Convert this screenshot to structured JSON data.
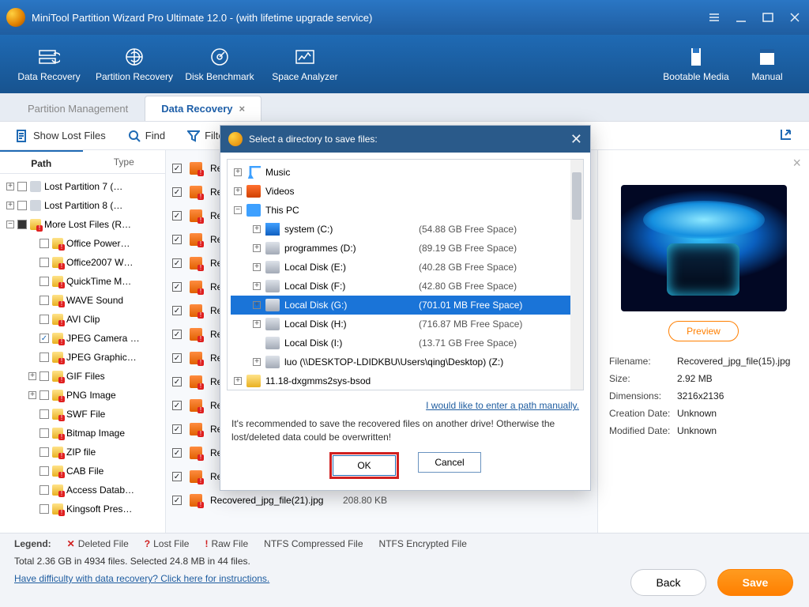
{
  "titlebar": {
    "title": "MiniTool Partition Wizard Pro Ultimate 12.0 - (with lifetime upgrade service)"
  },
  "ribbon": {
    "data_recovery": "Data Recovery",
    "partition_recovery": "Partition Recovery",
    "disk_benchmark": "Disk Benchmark",
    "space_analyzer": "Space Analyzer",
    "bootable_media": "Bootable Media",
    "manual": "Manual"
  },
  "main_tabs": {
    "partition_mgmt": "Partition Management",
    "data_recovery": "Data Recovery",
    "close": "×"
  },
  "filter_bar": {
    "show_lost": "Show Lost Files",
    "find": "Find",
    "filter": "Filter"
  },
  "tabs2": {
    "path": "Path",
    "type": "Type"
  },
  "tree": {
    "lost7": "Lost Partition 7 (…",
    "lost8": "Lost Partition 8 (…",
    "more": "More Lost Files (R…",
    "office_power": "Office Power…",
    "office2007": "Office2007 W…",
    "quicktime": "QuickTime M…",
    "wave": "WAVE Sound",
    "avi": "AVI Clip",
    "jpeg_cam": "JPEG Camera …",
    "jpeg_graphic": "JPEG Graphic…",
    "gif": "GIF Files",
    "png": "PNG Image",
    "swf": "SWF File",
    "bitmap": "Bitmap Image",
    "zip": "ZIP file",
    "cab": "CAB File",
    "access": "Access Datab…",
    "kingsoft": "Kingsoft Pres…"
  },
  "files": [
    {
      "name": "Rec",
      "size": ""
    },
    {
      "name": "Rec",
      "size": ""
    },
    {
      "name": "Rec",
      "size": ""
    },
    {
      "name": "Rec",
      "size": ""
    },
    {
      "name": "Rec",
      "size": ""
    },
    {
      "name": "Rec",
      "size": ""
    },
    {
      "name": "Rec",
      "size": ""
    },
    {
      "name": "Rec",
      "size": ""
    },
    {
      "name": "Rec",
      "size": ""
    },
    {
      "name": "Rec",
      "size": ""
    },
    {
      "name": "Rec",
      "size": ""
    },
    {
      "name": "Rec",
      "size": ""
    },
    {
      "name": "Rec",
      "size": ""
    },
    {
      "name": "Recovered_jpg_file(20).jpg",
      "size": "4.07 MB"
    },
    {
      "name": "Recovered_jpg_file(21).jpg",
      "size": "208.80 KB"
    }
  ],
  "preview": {
    "button": "Preview",
    "filename_k": "Filename:",
    "filename_v": "Recovered_jpg_file(15).jpg",
    "size_k": "Size:",
    "size_v": "2.92 MB",
    "dim_k": "Dimensions:",
    "dim_v": "3216x2136",
    "created_k": "Creation Date:",
    "created_v": "Unknown",
    "modified_k": "Modified Date:",
    "modified_v": "Unknown"
  },
  "footer": {
    "legend_label": "Legend:",
    "deleted": "Deleted File",
    "lost": "Lost File",
    "raw": "Raw File",
    "ntfs_comp": "NTFS Compressed File",
    "ntfs_enc": "NTFS Encrypted File",
    "totals": "Total 2.36 GB in 4934 files.  Selected 24.8 MB in 44 files.",
    "help": "Have difficulty with data recovery? Click here for instructions.",
    "back": "Back",
    "save": "Save"
  },
  "modal": {
    "title": "Select a directory to save files:",
    "items": {
      "music": "Music",
      "videos": "Videos",
      "thispc": "This PC",
      "system": "system (C:)",
      "system_free": "(54.88 GB Free Space)",
      "programmes": "programmes (D:)",
      "programmes_free": "(89.19 GB Free Space)",
      "e": "Local Disk (E:)",
      "e_free": "(40.28 GB Free Space)",
      "f": "Local Disk (F:)",
      "f_free": "(42.80 GB Free Space)",
      "g": "Local Disk (G:)",
      "g_free": "(701.01 MB Free Space)",
      "h": "Local Disk (H:)",
      "h_free": "(716.87 MB Free Space)",
      "i": "Local Disk (I:)",
      "i_free": "(13.71 GB Free Space)",
      "z": "luo (\\\\DESKTOP-LDIDKBU\\Users\\qing\\Desktop) (Z:)",
      "bsod": "11.18-dxgmms2sys-bsod"
    },
    "manual": "I would like to enter a path manually.",
    "warn": "It's recommended to save the recovered files on another drive! Otherwise the lost/deleted data could be overwritten!",
    "ok": "OK",
    "cancel": "Cancel"
  }
}
